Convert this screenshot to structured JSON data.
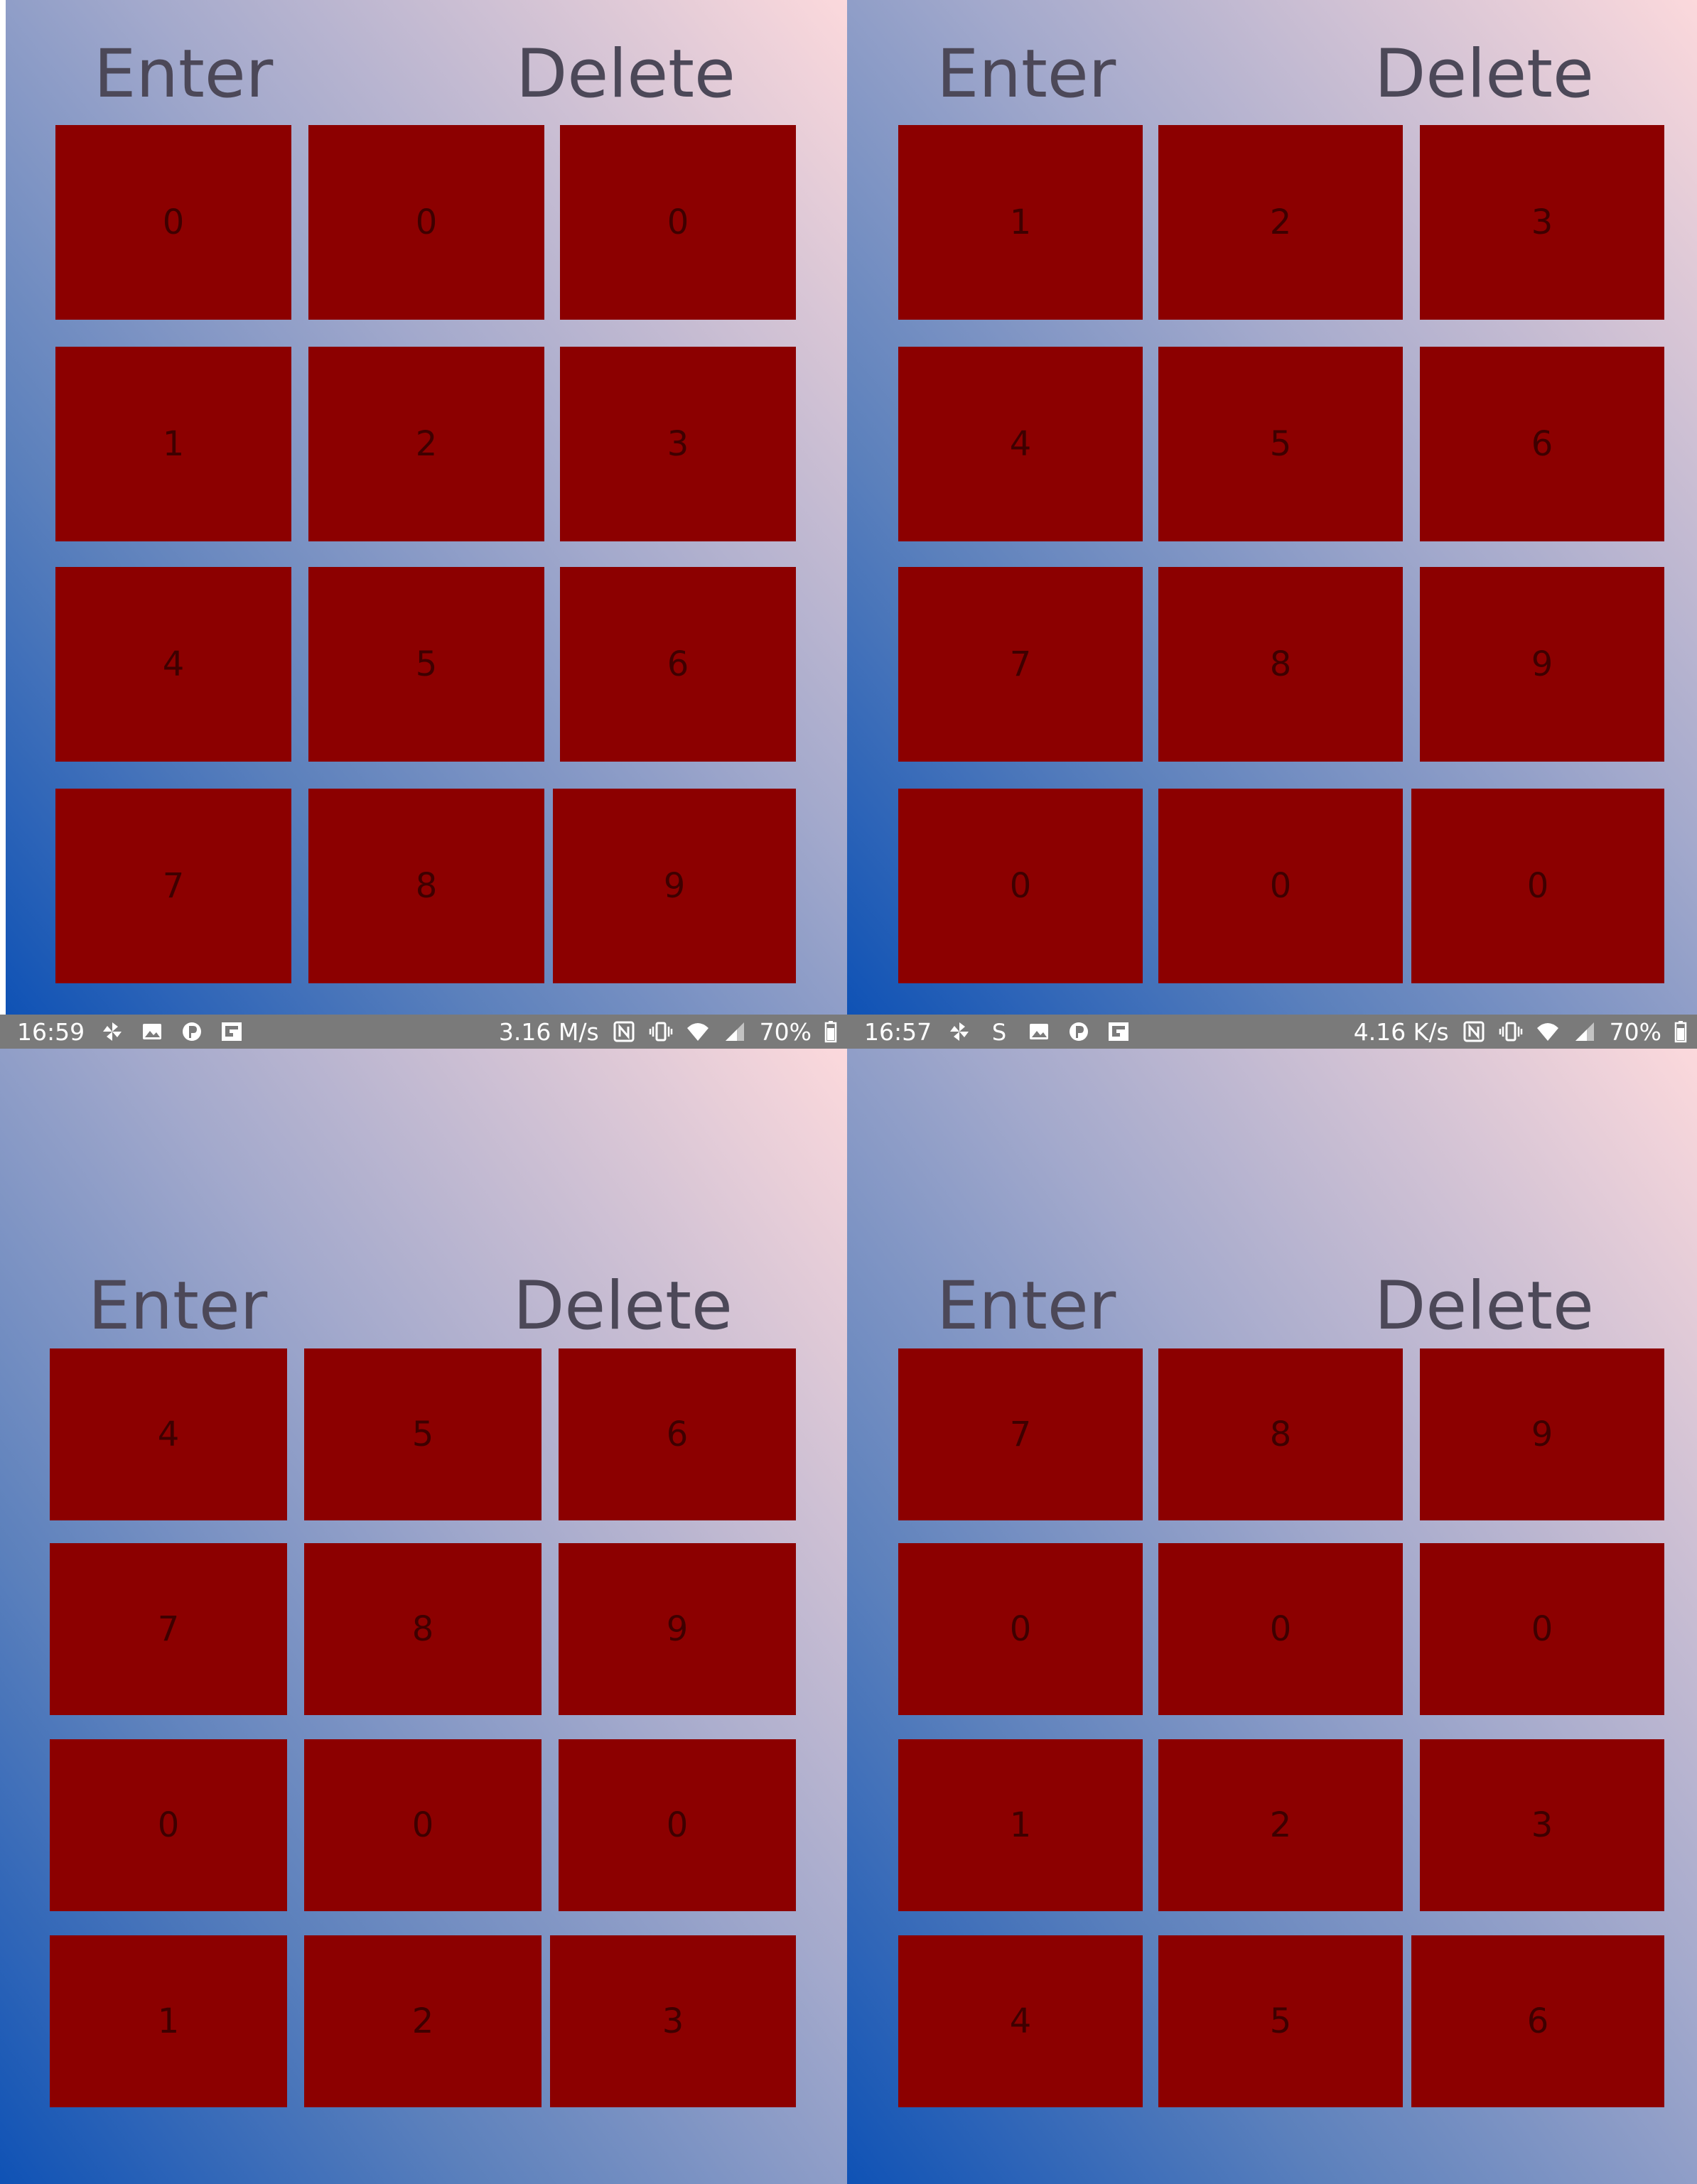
{
  "screens": [
    {
      "enter_label": "Enter",
      "delete_label": "Delete",
      "keys": [
        [
          "0",
          "0",
          "0"
        ],
        [
          "1",
          "2",
          "3"
        ],
        [
          "4",
          "5",
          "6"
        ],
        [
          "7",
          "8",
          "9"
        ]
      ]
    },
    {
      "enter_label": "Enter",
      "delete_label": "Delete",
      "keys": [
        [
          "1",
          "2",
          "3"
        ],
        [
          "4",
          "5",
          "6"
        ],
        [
          "7",
          "8",
          "9"
        ],
        [
          "0",
          "0",
          "0"
        ]
      ]
    },
    {
      "enter_label": "Enter",
      "delete_label": "Delete",
      "keys": [
        [
          "4",
          "5",
          "6"
        ],
        [
          "7",
          "8",
          "9"
        ],
        [
          "0",
          "0",
          "0"
        ],
        [
          "1",
          "2",
          "3"
        ]
      ]
    },
    {
      "enter_label": "Enter",
      "delete_label": "Delete",
      "keys": [
        [
          "7",
          "8",
          "9"
        ],
        [
          "0",
          "0",
          "0"
        ],
        [
          "1",
          "2",
          "3"
        ],
        [
          "4",
          "5",
          "6"
        ]
      ]
    }
  ],
  "status_bars": [
    {
      "time": "16:59",
      "left_icons": [
        "pinwheel-icon",
        "image-icon",
        "p-icon",
        "flipboard-icon"
      ],
      "speed": "3.16 M/s",
      "right_icons": [
        "nfc-icon",
        "vibrate-icon",
        "wifi-icon",
        "signal-icon"
      ],
      "battery": "70%"
    },
    {
      "time": "16:57",
      "left_icons": [
        "pinwheel-icon",
        "s-icon",
        "image-icon",
        "p-icon",
        "flipboard-icon"
      ],
      "speed": "4.16 K/s",
      "right_icons": [
        "nfc-icon",
        "vibrate-icon",
        "wifi-icon",
        "signal-icon"
      ],
      "battery": "70%"
    }
  ],
  "colors": {
    "key": "#8c0000",
    "key_text": "#3e0000",
    "label": "#4c4858",
    "status_bar": "#7a7a7a",
    "gradient_dark": "#0f52b5",
    "gradient_light": "#fcd9dc"
  }
}
